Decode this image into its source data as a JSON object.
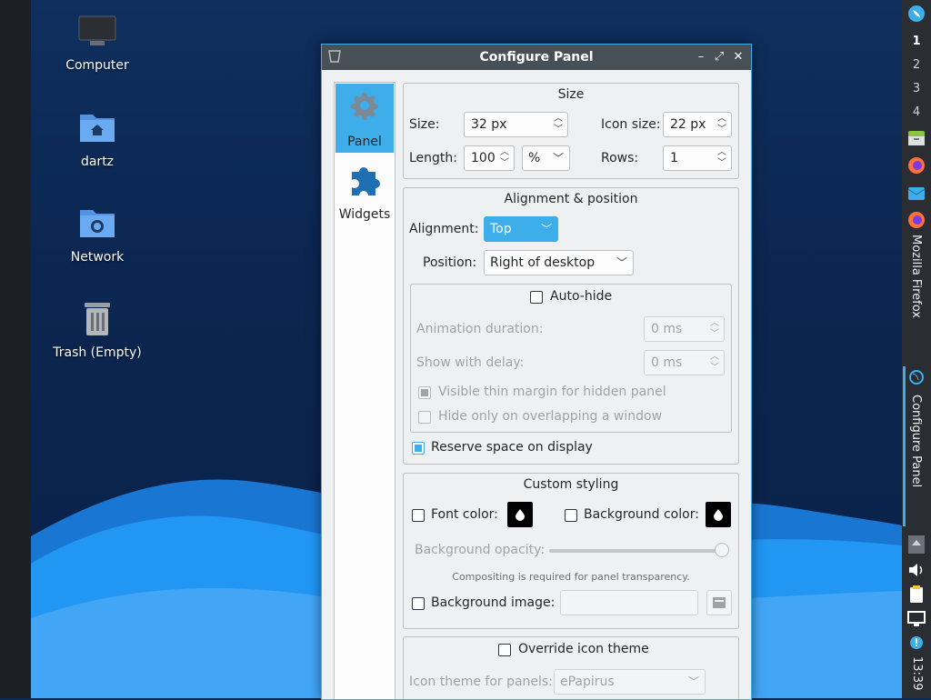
{
  "desktop": {
    "icons": [
      {
        "label": "Computer"
      },
      {
        "label": "dartz"
      },
      {
        "label": "Network"
      },
      {
        "label": "Trash (Empty)"
      }
    ]
  },
  "panel": {
    "workspaces": [
      "1",
      "2",
      "3",
      "4"
    ],
    "active_workspace": "1",
    "tasks": [
      {
        "label": "Mozilla Firefox"
      },
      {
        "label": "Configure Panel"
      }
    ],
    "clock": "13:39"
  },
  "dialog": {
    "title": "Configure Panel",
    "nav": [
      {
        "label": "Panel",
        "icon": "gear-icon"
      },
      {
        "label": "Widgets",
        "icon": "puzzle-icon"
      }
    ],
    "size": {
      "title": "Size",
      "size_label": "Size:",
      "size_value": "32 px",
      "icon_size_label": "Icon size:",
      "icon_size_value": "22 px",
      "length_label": "Length:",
      "length_value": "100",
      "length_unit": "%",
      "rows_label": "Rows:",
      "rows_value": "1"
    },
    "alignment": {
      "title": "Alignment & position",
      "alignment_label": "Alignment:",
      "alignment_value": "Top",
      "position_label": "Position:",
      "position_value": "Right of desktop",
      "autohide_label": "Auto-hide",
      "anim_label": "Animation duration:",
      "anim_value": "0 ms",
      "delay_label": "Show with delay:",
      "delay_value": "0 ms",
      "thin_margin_label": "Visible thin margin for hidden panel",
      "overlap_label": "Hide only on overlapping a window",
      "reserve_label": "Reserve space on display"
    },
    "styling": {
      "title": "Custom styling",
      "font_color_label": "Font color:",
      "bg_color_label": "Background color:",
      "opacity_label": "Background opacity:",
      "opacity_value": 1.0,
      "note": "Compositing is required for panel transparency.",
      "bg_image_label": "Background image:"
    },
    "icon_theme": {
      "override_label": "Override icon theme",
      "theme_label": "Icon theme for panels:",
      "theme_value": "ePapirus"
    }
  },
  "colors": {
    "accent": "#3daee9",
    "titlebar": "#475057",
    "window_bg": "#eff0f1"
  }
}
